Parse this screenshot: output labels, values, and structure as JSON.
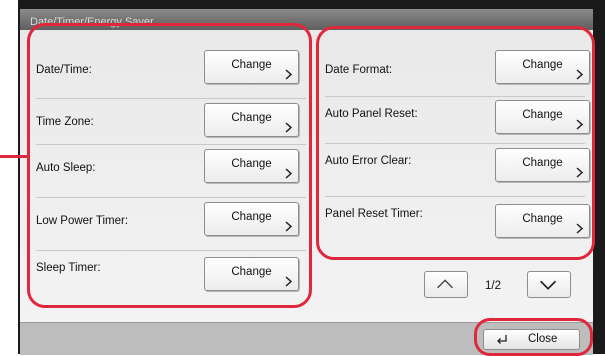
{
  "window": {
    "title": "Date/Timer/Energy Saver"
  },
  "left_column": {
    "rows": [
      {
        "label": "Date/Time:",
        "button": "Change"
      },
      {
        "label": "Time Zone:",
        "button": "Change"
      },
      {
        "label": "Auto Sleep:",
        "button": "Change"
      },
      {
        "label": "Low Power Timer:",
        "button": "Change"
      },
      {
        "label": "Sleep Timer:",
        "button": "Change"
      }
    ]
  },
  "right_column": {
    "rows": [
      {
        "label": "Date Format:",
        "button": "Change"
      },
      {
        "label": "Auto Panel Reset:",
        "button": "Change"
      },
      {
        "label": "Auto Error Clear:",
        "button": "Change"
      },
      {
        "label": "Panel Reset Timer:",
        "button": "Change"
      }
    ]
  },
  "pager": {
    "current": "1/2",
    "up_icon": "chevron-up-icon",
    "down_icon": "chevron-down-icon"
  },
  "footer": {
    "close_label": "Close",
    "close_icon": "return-icon"
  },
  "colors": {
    "highlight": "#e0283c",
    "title_bar": "#6f6f6f",
    "panel": "#eeeeee"
  }
}
